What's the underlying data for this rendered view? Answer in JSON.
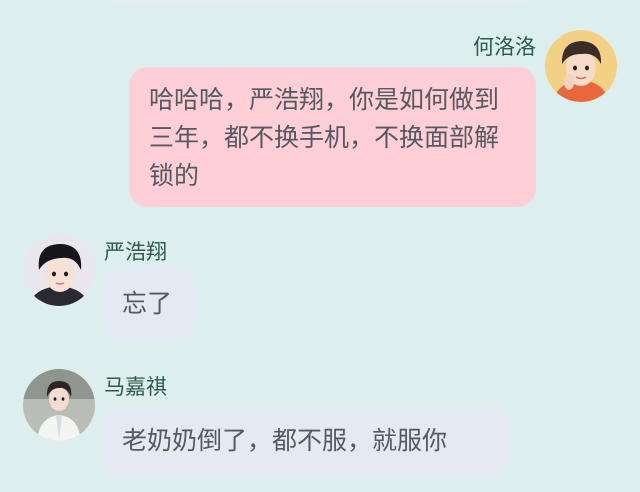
{
  "colors": {
    "background": "#dcefee",
    "outgoing_bubble": "#ffcfd7",
    "incoming_bubble": "#e5e9f1",
    "sender_name": "#2f5a4b",
    "message_text": "#555a60"
  },
  "messages": [
    {
      "sender": "何洛洛",
      "direction": "outgoing",
      "avatar_icon": "avatar-boy-portrait",
      "text": "哈哈哈，严浩翔，你是如何做到三年，都不换手机，不换面部解锁的"
    },
    {
      "sender": "严浩翔",
      "direction": "incoming",
      "avatar_icon": "avatar-boy-portrait",
      "text": "忘了"
    },
    {
      "sender": "马嘉祺",
      "direction": "incoming",
      "avatar_icon": "avatar-boy-portrait",
      "text": "老奶奶倒了，都不服，就服你"
    }
  ]
}
